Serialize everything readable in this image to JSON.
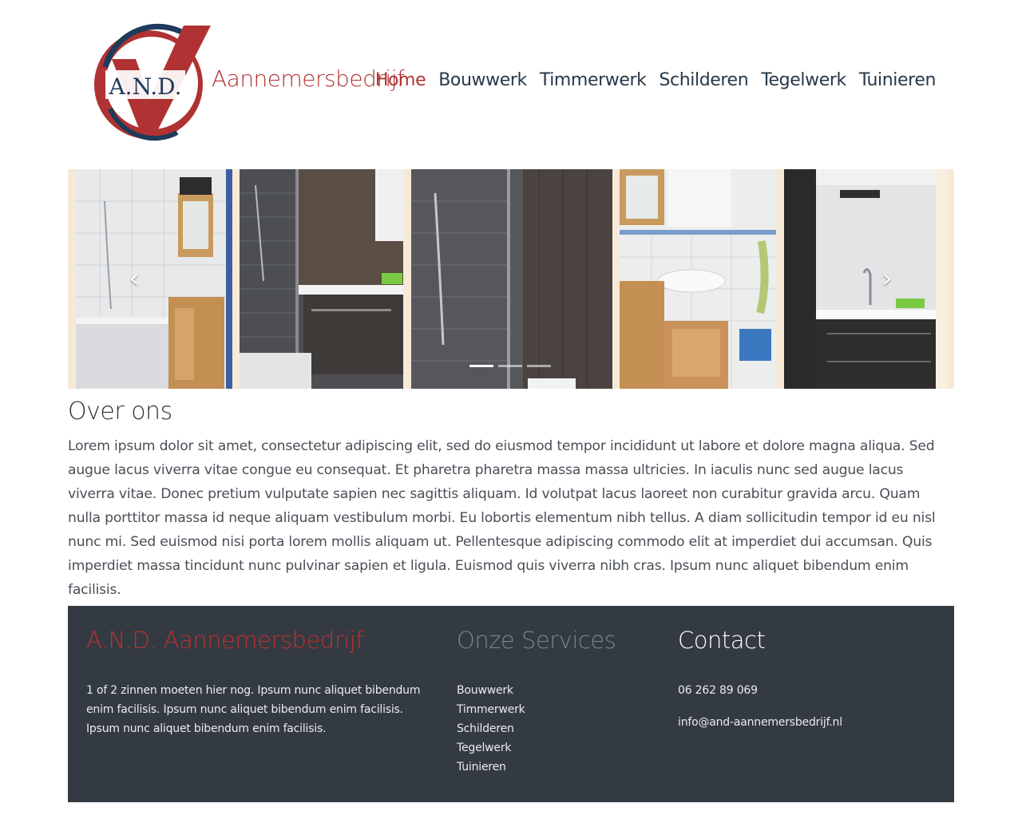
{
  "header": {
    "logo_text": "A.N.D.",
    "brand": "Aannemersbedrijf",
    "brand_color": "#b03232",
    "nav": [
      {
        "label": "Home",
        "active": true
      },
      {
        "label": "Bouwwerk",
        "active": false
      },
      {
        "label": "Timmerwerk",
        "active": false
      },
      {
        "label": "Schilderen",
        "active": false
      },
      {
        "label": "Tegelwerk",
        "active": false
      },
      {
        "label": "Tuinieren",
        "active": false
      }
    ]
  },
  "carousel": {
    "prev_icon": "chevron-left-icon",
    "next_icon": "chevron-right-icon",
    "slide_count": 3,
    "active_slide": 1
  },
  "about": {
    "title": "Over ons",
    "text": "Lorem ipsum dolor sit amet, consectetur adipiscing elit, sed do eiusmod tempor incididunt ut labore et dolore magna aliqua. Sed augue lacus viverra vitae congue eu consequat. Et pharetra pharetra massa massa ultricies. In iaculis nunc sed augue lacus viverra vitae. Donec pretium vulputate sapien nec sagittis aliquam. Id volutpat lacus laoreet non curabitur gravida arcu. Quam nulla porttitor massa id neque aliquam vestibulum morbi. Eu lobortis elementum nibh tellus. A diam sollicitudin tempor id eu nisl nunc mi. Sed euismod nisi porta lorem mollis aliquam ut. Pellentesque adipiscing commodo elit at imperdiet dui accumsan. Quis imperdiet massa tincidunt nunc pulvinar sapien et ligula. Euismod quis viverra nibh cras. Ipsum nunc aliquet bibendum enim facilisis."
  },
  "footer": {
    "company": {
      "title": "A.N.D. Aannemersbedrijf",
      "text": "1 of 2 zinnen moeten hier nog. Ipsum nunc aliquet bibendum enim facilisis. Ipsum nunc aliquet bibendum enim facilisis. Ipsum nunc aliquet bibendum enim facilisis."
    },
    "services": {
      "title": "Onze Services",
      "items": [
        "Bouwwerk",
        "Timmerwerk",
        "Schilderen",
        "Tegelwerk",
        "Tuinieren"
      ]
    },
    "contact": {
      "title": "Contact",
      "phone": "06 262 89 069",
      "email": "info@and-aannemersbedrijf.nl"
    },
    "background": "#343a42"
  }
}
